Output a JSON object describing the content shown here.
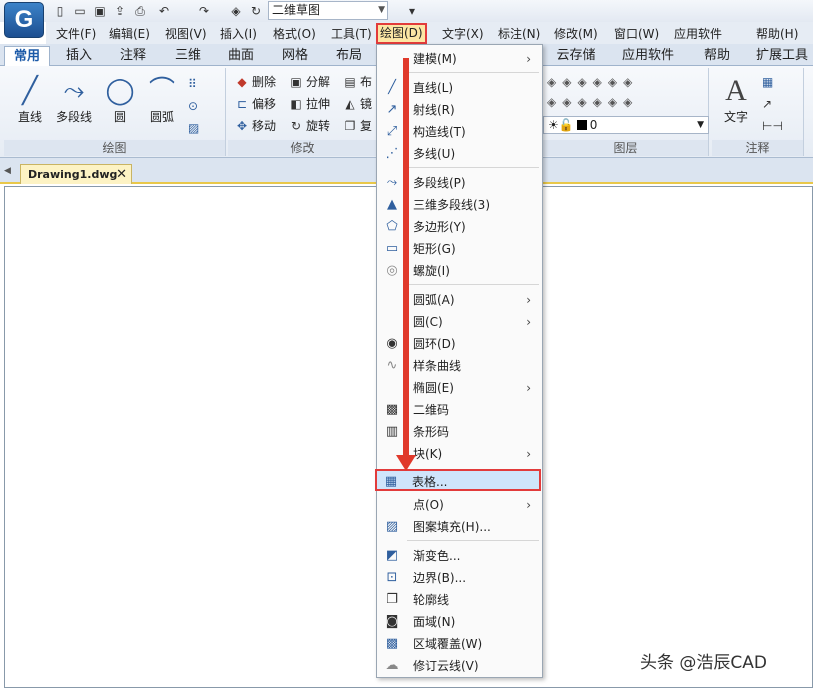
{
  "titlebar": {
    "workspace": "二维草图"
  },
  "menubar": {
    "items": [
      "文件(F)",
      "编辑(E)",
      "视图(V)",
      "插入(I)",
      "格式(O)",
      "工具(T)",
      "绘图(D)",
      "文字(X)",
      "标注(N)",
      "修改(M)",
      "窗口(W)",
      "应用软件",
      "帮助(H)"
    ],
    "active": "绘图(D)"
  },
  "ribbon": {
    "tabs": [
      "常用",
      "插入",
      "注释",
      "三维",
      "曲面",
      "网格",
      "布局",
      "云存储",
      "应用软件",
      "帮助",
      "扩展工具"
    ],
    "selected_tab": "常用",
    "draw_group": {
      "title": "绘图",
      "buttons": [
        "直线",
        "多段线",
        "圆",
        "圆弧"
      ]
    },
    "modify_group": {
      "title": "修改",
      "buttons": [
        "删除",
        "分解",
        "布",
        "偏移",
        "拉伸",
        "镜",
        "移动",
        "旋转",
        "复"
      ]
    },
    "layer_group": {
      "title": "图层",
      "layer_value": "0"
    },
    "annot_group": {
      "title": "注释",
      "text_button": "文字"
    }
  },
  "document": {
    "tab": "Drawing1.dwg"
  },
  "menu": {
    "items": [
      {
        "label": "建模(M)",
        "icon": "none",
        "submenu": true
      },
      {
        "label": "直线(L)",
        "icon": "line-icon"
      },
      {
        "label": "射线(R)",
        "icon": "ray-icon"
      },
      {
        "label": "构造线(T)",
        "icon": "construction-line-icon"
      },
      {
        "label": "多线(U)",
        "icon": "multiline-icon"
      },
      {
        "label": "多段线(P)",
        "icon": "polyline-icon"
      },
      {
        "label": "三维多段线(3)",
        "icon": "3d-polyline-icon"
      },
      {
        "label": "多边形(Y)",
        "icon": "polygon-icon"
      },
      {
        "label": "矩形(G)",
        "icon": "rectangle-icon"
      },
      {
        "label": "螺旋(I)",
        "icon": "helix-icon"
      },
      {
        "label": "圆弧(A)",
        "icon": "none",
        "submenu": true
      },
      {
        "label": "圆(C)",
        "icon": "none",
        "submenu": true
      },
      {
        "label": "圆环(D)",
        "icon": "donut-icon"
      },
      {
        "label": "样条曲线",
        "icon": "spline-icon"
      },
      {
        "label": "椭圆(E)",
        "icon": "none",
        "submenu": true
      },
      {
        "label": "二维码",
        "icon": "qrcode-icon"
      },
      {
        "label": "条形码",
        "icon": "barcode-icon"
      },
      {
        "label": "块(K)",
        "icon": "none",
        "submenu": true
      },
      {
        "label": "表格...",
        "icon": "table-icon",
        "highlighted": true
      },
      {
        "label": "点(O)",
        "icon": "none",
        "submenu": true
      },
      {
        "label": "图案填充(H)...",
        "icon": "hatch-icon"
      },
      {
        "label": "渐变色...",
        "icon": "gradient-icon"
      },
      {
        "label": "边界(B)...",
        "icon": "boundary-icon"
      },
      {
        "label": "轮廓线",
        "icon": "outline-icon"
      },
      {
        "label": "面域(N)",
        "icon": "region-icon"
      },
      {
        "label": "区域覆盖(W)",
        "icon": "wipeout-icon"
      },
      {
        "label": "修订云线(V)",
        "icon": "revcloud-icon"
      }
    ]
  },
  "watermark": "头条 @浩辰CAD",
  "colors": {
    "highlight_border": "#e23b3b",
    "arrow": "#e0392b",
    "menu_active_bg": "#fce6a4"
  }
}
